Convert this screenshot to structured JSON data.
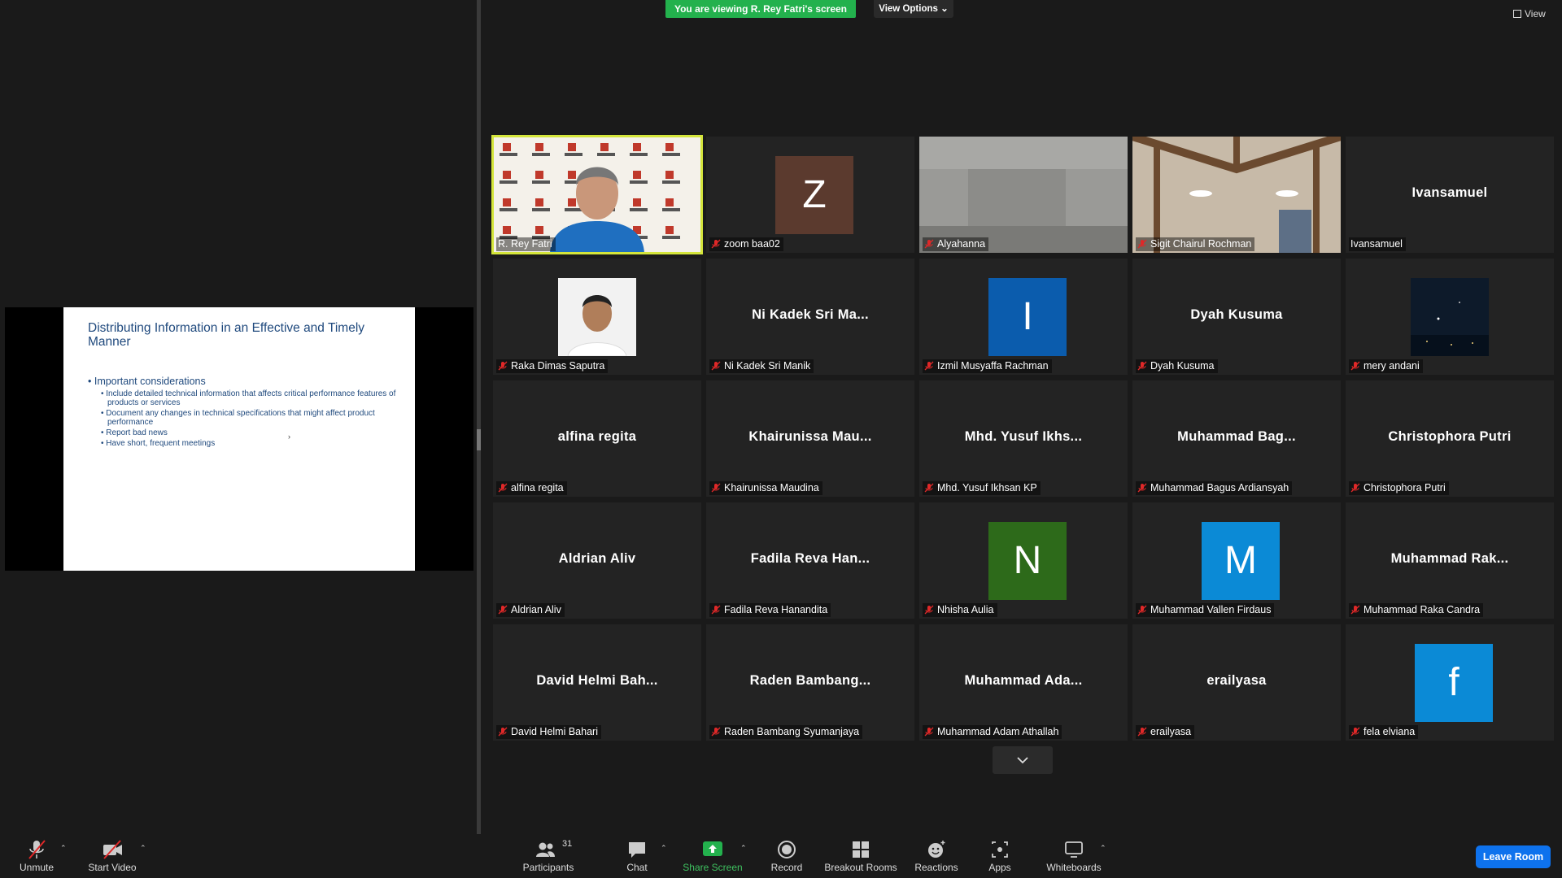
{
  "banner": {
    "text": "You are viewing R. Rey Fatri's screen",
    "view_options": "View Options",
    "view": "View"
  },
  "slide": {
    "title": "Distributing Information in an Effective and Timely Manner",
    "bullet": "• Important considerations",
    "sub_bullets": [
      "• Include detailed technical information that affects critical performance features of products or services",
      "• Document any changes in technical specifications that might affect product performance",
      "• Report bad news",
      "• Have short, frequent meetings"
    ]
  },
  "participants": [
    {
      "label": "R. Rey Fatri",
      "big": "",
      "kind": "video-presenter",
      "muted": false
    },
    {
      "label": "zoom baa02",
      "big": "Z",
      "kind": "avatar",
      "color": "#5b3a2e",
      "muted": true
    },
    {
      "label": "Alyahanna",
      "big": "",
      "kind": "video-room",
      "muted": true
    },
    {
      "label": "Sigit Chairul Rochman",
      "big": "",
      "kind": "video-ceiling",
      "muted": true
    },
    {
      "label": "Ivansamuel",
      "big": "Ivansamuel",
      "kind": "name",
      "muted": false
    },
    {
      "label": "Raka Dimas Saputra",
      "big": "",
      "kind": "photo",
      "muted": true
    },
    {
      "label": "Ni Kadek Sri Manik",
      "big": "Ni Kadek Sri Ma...",
      "kind": "name",
      "muted": true
    },
    {
      "label": "Izmil Musyaffa Rachman",
      "big": "I",
      "kind": "avatar",
      "color": "#0b5cad",
      "muted": true
    },
    {
      "label": "Dyah Kusuma",
      "big": "Dyah Kusuma",
      "kind": "name",
      "muted": true
    },
    {
      "label": "mery andani",
      "big": "",
      "kind": "night",
      "muted": true
    },
    {
      "label": "alfina regita",
      "big": "alfina regita",
      "kind": "name",
      "muted": true
    },
    {
      "label": "Khairunissa Maudina",
      "big": "Khairunissa  Mau...",
      "kind": "name",
      "muted": true
    },
    {
      "label": "Mhd. Yusuf Ikhsan KP",
      "big": "Mhd.  Yusuf  Ikhs...",
      "kind": "name",
      "muted": true
    },
    {
      "label": "Muhammad Bagus Ardiansyah",
      "big": "Muhammad  Bag...",
      "kind": "name",
      "muted": true
    },
    {
      "label": "Christophora Putri",
      "big": "Christophora Putri",
      "kind": "name",
      "muted": true
    },
    {
      "label": "Aldrian Aliv",
      "big": "Aldrian Aliv",
      "kind": "name",
      "muted": true
    },
    {
      "label": "Fadila Reva Hanandita",
      "big": "Fadila  Reva  Han...",
      "kind": "name",
      "muted": true
    },
    {
      "label": "Nhisha Aulia",
      "big": "N",
      "kind": "avatar",
      "color": "#2d6a1a",
      "muted": true
    },
    {
      "label": "Muhammad Vallen Firdaus",
      "big": "M",
      "kind": "avatar",
      "color": "#0b8ad6",
      "muted": true
    },
    {
      "label": "Muhammad Raka Candra",
      "big": "Muhammad  Rak...",
      "kind": "name",
      "muted": true
    },
    {
      "label": "David Helmi Bahari",
      "big": "David  Helmi  Bah...",
      "kind": "name",
      "muted": true
    },
    {
      "label": "Raden Bambang Syumanjaya",
      "big": "Raden  Bambang...",
      "kind": "name",
      "muted": true
    },
    {
      "label": "Muhammad Adam Athallah",
      "big": "Muhammad  Ada...",
      "kind": "name",
      "muted": true
    },
    {
      "label": "erailyasa",
      "big": "erailyasa",
      "kind": "name",
      "muted": true
    },
    {
      "label": "fela elviana",
      "big": "f",
      "kind": "avatar",
      "color": "#0b8ad6",
      "muted": true
    }
  ],
  "toolbar": {
    "unmute": "Unmute",
    "start_video": "Start Video",
    "participants": "Participants",
    "participants_count": "31",
    "chat": "Chat",
    "share_screen": "Share Screen",
    "record": "Record",
    "breakout": "Breakout Rooms",
    "reactions": "Reactions",
    "apps": "Apps",
    "whiteboards": "Whiteboards",
    "leave": "Leave Room"
  },
  "colors": {
    "share_green": "#23b14d",
    "leave_blue": "#0e72ed",
    "active_speaker": "#d4e53b",
    "mute_red": "#e02828"
  }
}
